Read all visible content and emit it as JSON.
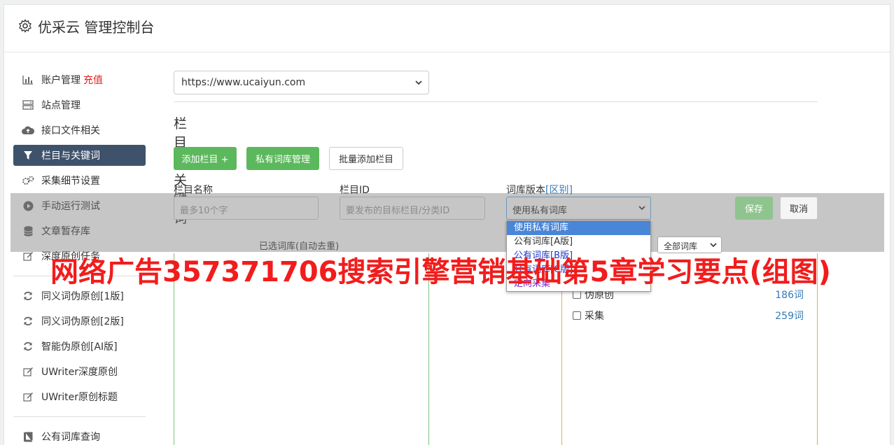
{
  "app": {
    "title": "优采云 管理控制台"
  },
  "sidebar": {
    "items": [
      {
        "label": "账户管理",
        "extra": "充值"
      },
      {
        "label": "站点管理"
      },
      {
        "label": "接口文件相关"
      },
      {
        "label": "栏目与关键词"
      },
      {
        "label": "采集细节设置"
      },
      {
        "label": "手动运行测试"
      },
      {
        "label": "文章暂存库"
      },
      {
        "label": "深度原创任务"
      },
      {
        "label": "同义词伪原创[1版]"
      },
      {
        "label": "同义词伪原创[2版]"
      },
      {
        "label": "智能伪原创[AI版]"
      },
      {
        "label": "UWriter深度原创"
      },
      {
        "label": "UWriter原创标题"
      },
      {
        "label": "公有词库查询"
      }
    ]
  },
  "main": {
    "site_url": "https://www.ucaiyun.com",
    "section_title": "栏目与关键词",
    "buttons": {
      "add_column": "添加栏目 +",
      "private_lib": "私有词库管理",
      "batch_add": "批量添加栏目"
    },
    "form": {
      "name_label": "栏目名称",
      "name_placeholder": "最多10个字",
      "id_label": "栏目ID",
      "id_placeholder": "要发布的目标栏目/分类ID",
      "version_label": "词库版本",
      "version_link": "[区别]",
      "version_value": "使用私有词库",
      "save": "保存",
      "cancel": "取消"
    },
    "dropdown_options": [
      "使用私有词库",
      "公有词库[A版]",
      "公有词库[B版]",
      "公有词库[C版]",
      "定向采集"
    ],
    "selected_title": "已选词库(自动去重)",
    "filter": "全部词库",
    "libraries": [
      {
        "name": "伪原创",
        "count": "186词"
      },
      {
        "name": "采集",
        "count": "259词"
      }
    ]
  },
  "watermark": "网络广告357371706搜索引擎营销基础第5章学习要点(组图)"
}
